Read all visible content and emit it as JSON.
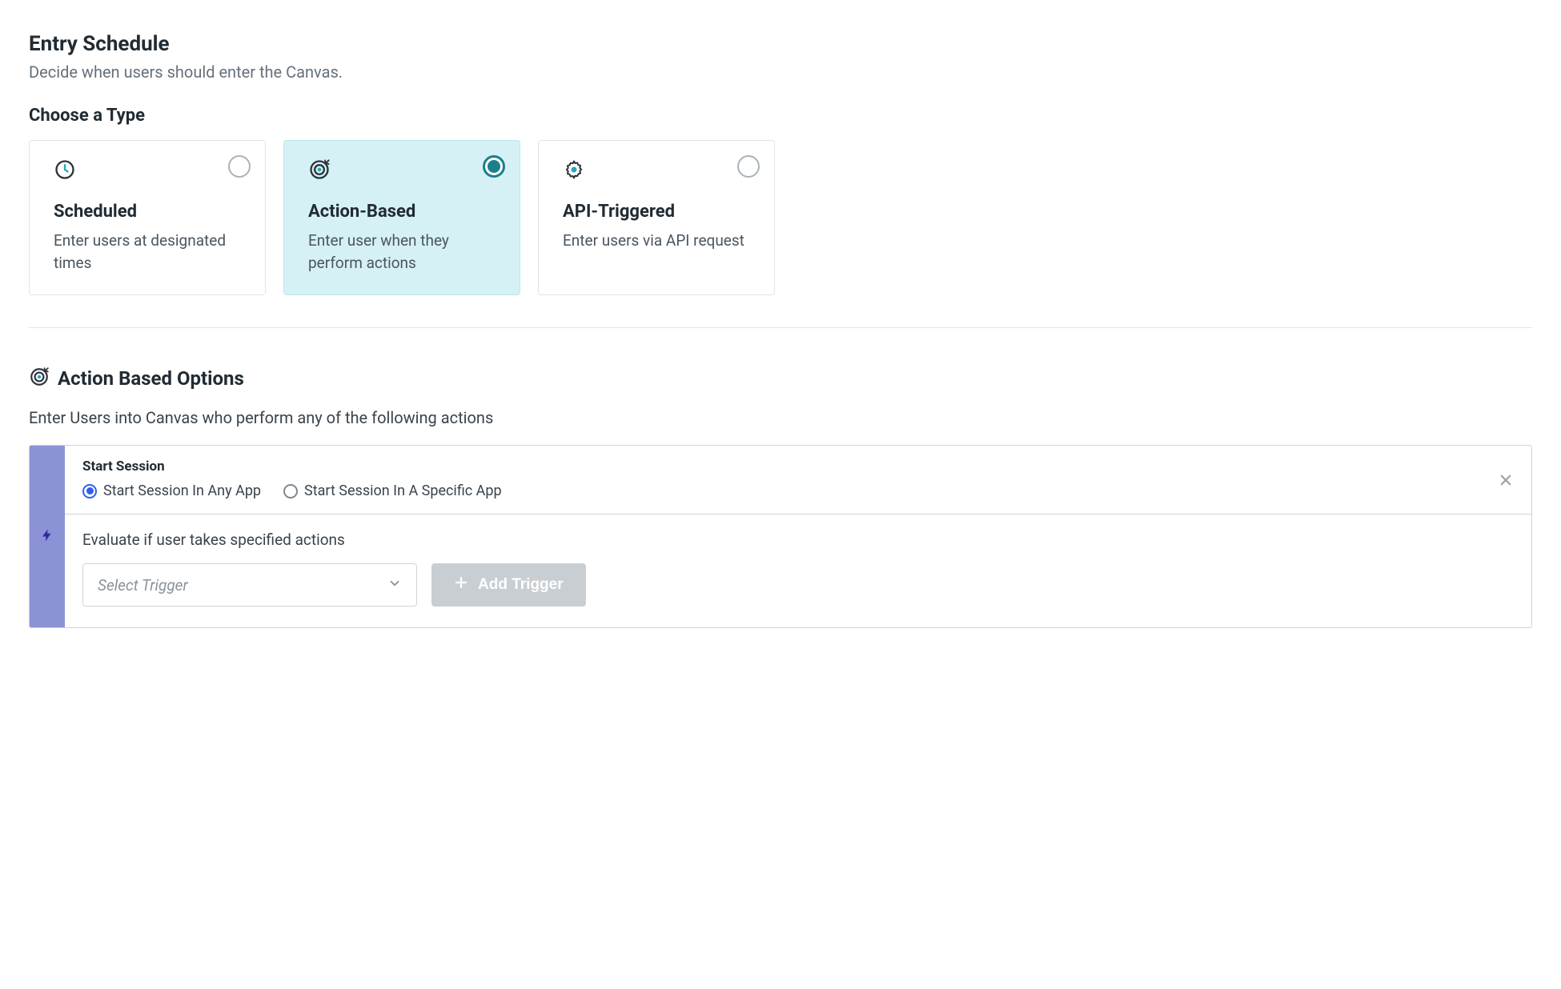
{
  "header": {
    "title": "Entry Schedule",
    "subtitle": "Decide when users should enter the Canvas."
  },
  "choose_type": {
    "heading": "Choose a Type",
    "cards": [
      {
        "icon": "clock",
        "title": "Scheduled",
        "desc": "Enter users at designated times",
        "selected": false
      },
      {
        "icon": "target",
        "title": "Action-Based",
        "desc": "Enter user when they perform actions",
        "selected": true
      },
      {
        "icon": "gear",
        "title": "API-Triggered",
        "desc": "Enter users via API request",
        "selected": false
      }
    ]
  },
  "action_options": {
    "heading": "Action Based Options",
    "subheading": "Enter Users into Canvas who perform any of the following actions"
  },
  "trigger": {
    "name": "Start Session",
    "radios": [
      {
        "label": "Start Session In Any App",
        "selected": true
      },
      {
        "label": "Start Session In A Specific App",
        "selected": false
      }
    ],
    "evaluate_label": "Evaluate if user takes specified actions",
    "select_placeholder": "Select Trigger",
    "add_button_label": "Add Trigger"
  }
}
